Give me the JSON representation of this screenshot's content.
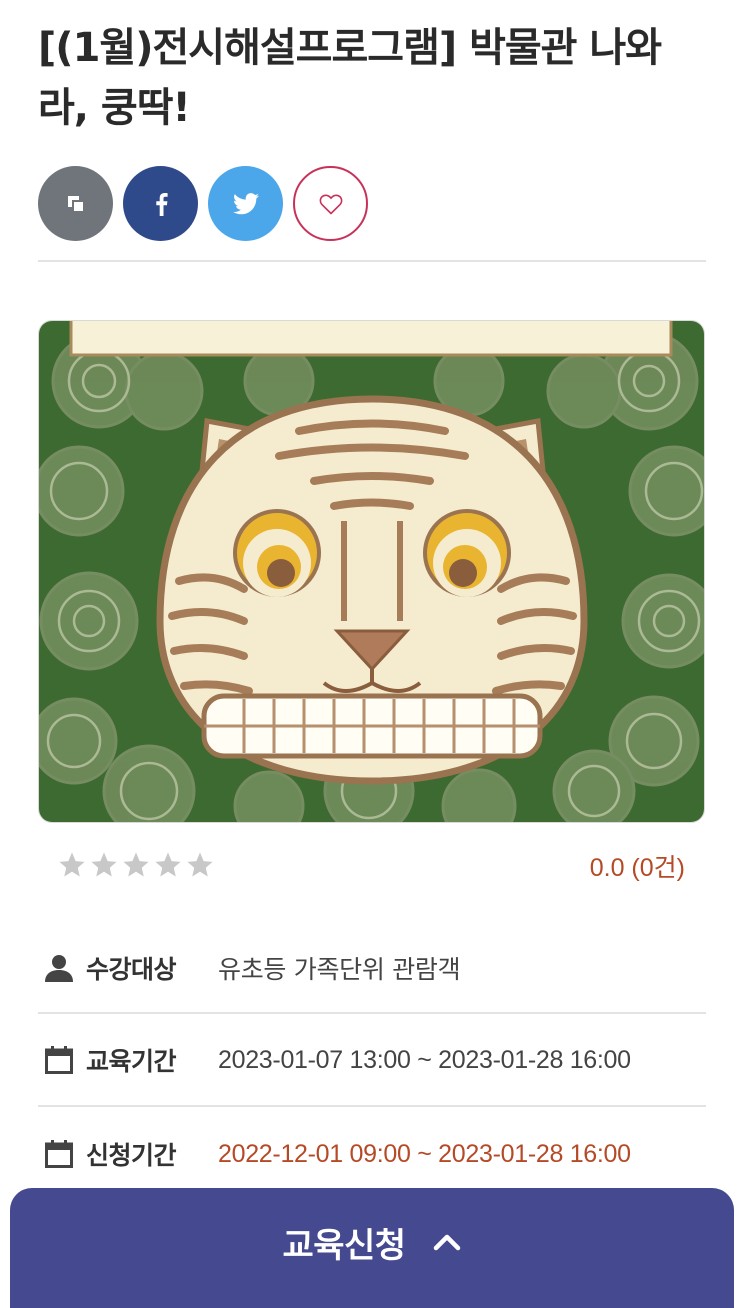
{
  "title": "[(1월)전시해설프로그램] 박물관 나와라, 쿵딱!",
  "share": {
    "copy_icon": "copy-icon",
    "facebook_icon": "facebook-icon",
    "twitter_icon": "twitter-icon",
    "like_icon": "heart-outline-icon"
  },
  "rating": {
    "score_text": "0.0 (0건)",
    "stars_filled": 0,
    "stars_total": 5
  },
  "info": [
    {
      "icon": "user-icon",
      "label": "수강대상",
      "value": "유초등 가족단위 관람객"
    },
    {
      "icon": "calendar-icon",
      "label": "교육기간",
      "value": "2023-01-07 13:00 ~ 2023-01-28 16:00"
    },
    {
      "icon": "calendar-icon",
      "label": "신청기간",
      "value": "2022-12-01 09:00 ~ 2023-01-28 16:00"
    }
  ],
  "apply_button": {
    "label": "교육신청",
    "icon": "chevron-up-icon"
  },
  "colors": {
    "accent_red": "#b54a26",
    "apply_bar": "#45498f",
    "facebook": "#2f4a8a",
    "twitter": "#4ca6ea",
    "like_border": "#c8315a"
  }
}
